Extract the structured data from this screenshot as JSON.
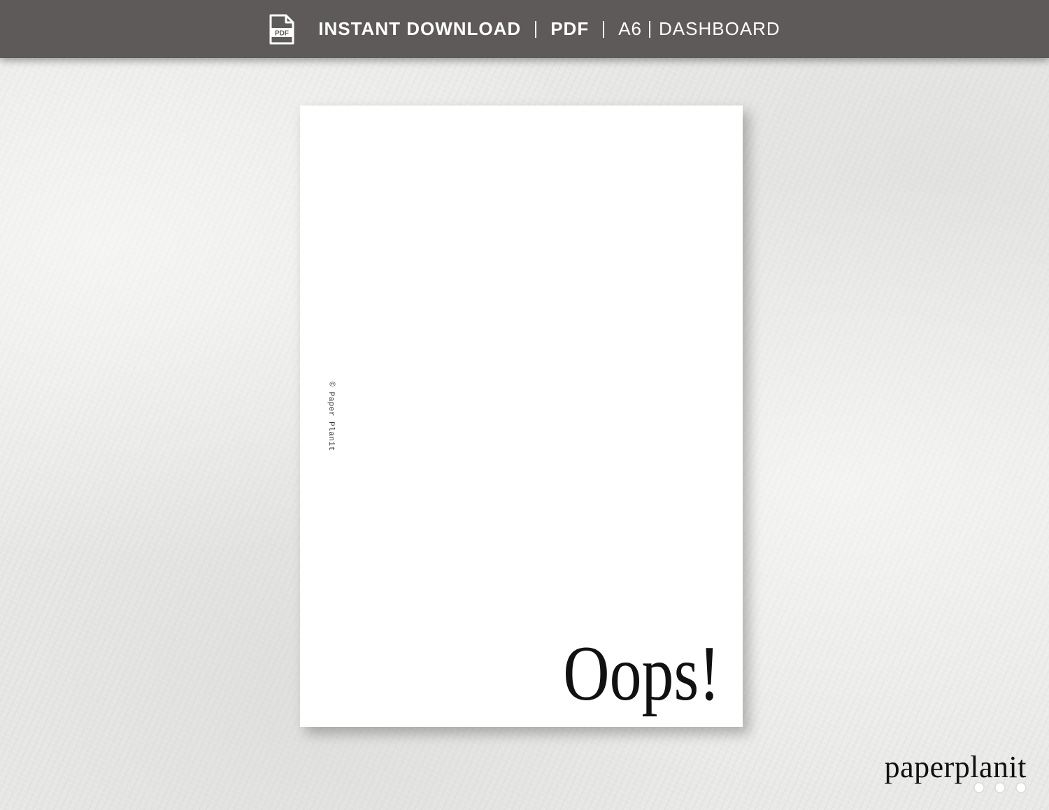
{
  "top_bar": {
    "items": [
      {
        "label": "INSTANT DOWNLOAD",
        "weight": "bold"
      },
      {
        "label": "PDF",
        "weight": "bold"
      },
      {
        "label": "A6",
        "weight": "normal"
      },
      {
        "label": "DASHBOARD",
        "weight": "normal"
      }
    ],
    "icon": {
      "name": "pdf-file-icon",
      "text": "PDF"
    },
    "background_color": "#5e5a59",
    "text_color": "#ffffff"
  },
  "paper": {
    "copyright": "© Paper Planit",
    "headline": "Oops!"
  },
  "brand": {
    "wordmark": "paperplanit",
    "dots_icon": "three-dots-icon"
  }
}
